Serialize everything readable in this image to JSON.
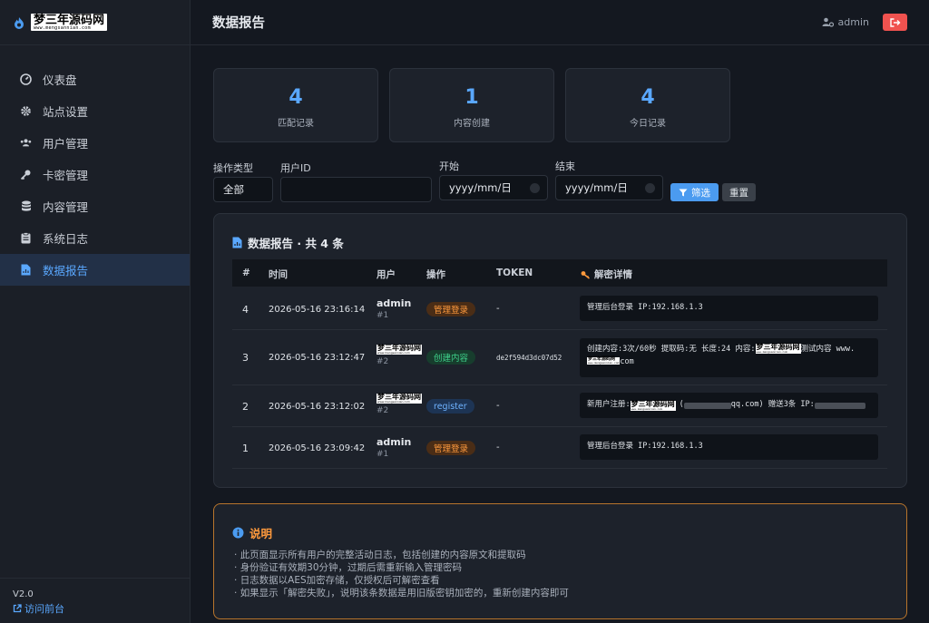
{
  "brand": {
    "logo_main": "梦三年源码网",
    "logo_sub": "www.mengsannian.com"
  },
  "sidebar": {
    "items": [
      {
        "label": "仪表盘",
        "icon": "dashboard-icon"
      },
      {
        "label": "站点设置",
        "icon": "gear-icon"
      },
      {
        "label": "用户管理",
        "icon": "users-icon"
      },
      {
        "label": "卡密管理",
        "icon": "key-icon"
      },
      {
        "label": "内容管理",
        "icon": "database-icon"
      },
      {
        "label": "系统日志",
        "icon": "clipboard-icon"
      },
      {
        "label": "数据报告",
        "icon": "file-chart-icon",
        "active": true
      }
    ],
    "version": "V2.0",
    "front_link": "访问前台"
  },
  "header": {
    "title": "数据报告",
    "username": "admin"
  },
  "stats": [
    {
      "value": "4",
      "label": "匹配记录"
    },
    {
      "value": "1",
      "label": "内容创建"
    },
    {
      "value": "4",
      "label": "今日记录"
    }
  ],
  "filters": {
    "type_label": "操作类型",
    "type_value": "全部",
    "uid_label": "用户ID",
    "uid_value": "",
    "start_label": "开始",
    "start_placeholder": "yyyy/mm/日",
    "end_label": "结束",
    "end_placeholder": "yyyy/mm/日",
    "filter_btn": "筛选",
    "reset_btn": "重置"
  },
  "report": {
    "title": "数据报告 · 共 4 条",
    "columns": [
      "#",
      "时间",
      "用户",
      "操作",
      "TOKEN",
      "解密详情"
    ],
    "rows": [
      {
        "no": "4",
        "time": "2026-05-16 23:16:14",
        "user": "admin",
        "uid": "#1",
        "action": "管理登录",
        "token": "-",
        "detail": "管理后台登录 IP:192.168.1.3"
      },
      {
        "no": "3",
        "time": "2026-05-16 23:12:47",
        "user": "梦三年源码网",
        "uid": "#2",
        "action": "创建内容",
        "token": "de2f594d3dc07d52",
        "detail_a": "创建内容:3次/60秒 提取码:无 长度:24 内容:",
        "detail_b": "测试内容  www.",
        "detail_c": "com"
      },
      {
        "no": "2",
        "time": "2026-05-16 23:12:02",
        "user": "梦三年源码网",
        "uid": "#2",
        "action": "register",
        "token": "-",
        "detail_a": "新用户注册:",
        "detail_b": "(",
        "detail_c": "qq.com) 赠送3条 IP:"
      },
      {
        "no": "1",
        "time": "2026-05-16 23:09:42",
        "user": "admin",
        "uid": "#1",
        "action": "管理登录",
        "token": "-",
        "detail": "管理后台登录 IP:192.168.1.3"
      }
    ]
  },
  "note": {
    "title": "说明",
    "items": [
      "此页面显示所有用户的完整活动日志，包括创建的内容原文和提取码",
      "身份验证有效期30分钟，过期后需重新输入管理密码",
      "日志数据以AES加密存储，仅授权后可解密查看",
      "如果显示「解密失败」，说明该条数据是用旧版密钥加密的，重新创建内容即可"
    ]
  },
  "colors": {
    "accent": "#5aa8ff",
    "danger": "#f0524f",
    "warning": "#ff9a3d",
    "success": "#3ed08a"
  }
}
